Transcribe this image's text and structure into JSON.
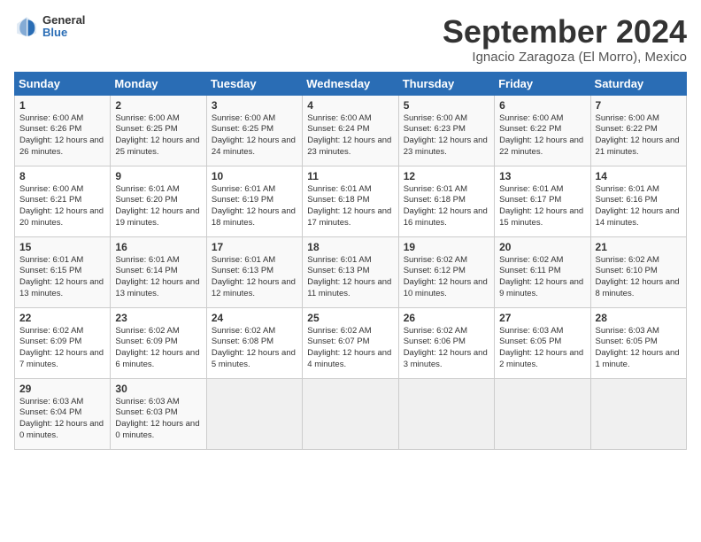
{
  "logo": {
    "general": "General",
    "blue": "Blue"
  },
  "title": "September 2024",
  "location": "Ignacio Zaragoza (El Morro), Mexico",
  "days_header": [
    "Sunday",
    "Monday",
    "Tuesday",
    "Wednesday",
    "Thursday",
    "Friday",
    "Saturday"
  ],
  "weeks": [
    [
      {
        "day": "1",
        "sunrise": "6:00 AM",
        "sunset": "6:26 PM",
        "daylight": "12 hours and 26 minutes."
      },
      {
        "day": "2",
        "sunrise": "6:00 AM",
        "sunset": "6:25 PM",
        "daylight": "12 hours and 25 minutes."
      },
      {
        "day": "3",
        "sunrise": "6:00 AM",
        "sunset": "6:25 PM",
        "daylight": "12 hours and 24 minutes."
      },
      {
        "day": "4",
        "sunrise": "6:00 AM",
        "sunset": "6:24 PM",
        "daylight": "12 hours and 23 minutes."
      },
      {
        "day": "5",
        "sunrise": "6:00 AM",
        "sunset": "6:23 PM",
        "daylight": "12 hours and 23 minutes."
      },
      {
        "day": "6",
        "sunrise": "6:00 AM",
        "sunset": "6:22 PM",
        "daylight": "12 hours and 22 minutes."
      },
      {
        "day": "7",
        "sunrise": "6:00 AM",
        "sunset": "6:22 PM",
        "daylight": "12 hours and 21 minutes."
      }
    ],
    [
      {
        "day": "8",
        "sunrise": "6:00 AM",
        "sunset": "6:21 PM",
        "daylight": "12 hours and 20 minutes."
      },
      {
        "day": "9",
        "sunrise": "6:01 AM",
        "sunset": "6:20 PM",
        "daylight": "12 hours and 19 minutes."
      },
      {
        "day": "10",
        "sunrise": "6:01 AM",
        "sunset": "6:19 PM",
        "daylight": "12 hours and 18 minutes."
      },
      {
        "day": "11",
        "sunrise": "6:01 AM",
        "sunset": "6:18 PM",
        "daylight": "12 hours and 17 minutes."
      },
      {
        "day": "12",
        "sunrise": "6:01 AM",
        "sunset": "6:18 PM",
        "daylight": "12 hours and 16 minutes."
      },
      {
        "day": "13",
        "sunrise": "6:01 AM",
        "sunset": "6:17 PM",
        "daylight": "12 hours and 15 minutes."
      },
      {
        "day": "14",
        "sunrise": "6:01 AM",
        "sunset": "6:16 PM",
        "daylight": "12 hours and 14 minutes."
      }
    ],
    [
      {
        "day": "15",
        "sunrise": "6:01 AM",
        "sunset": "6:15 PM",
        "daylight": "12 hours and 13 minutes."
      },
      {
        "day": "16",
        "sunrise": "6:01 AM",
        "sunset": "6:14 PM",
        "daylight": "12 hours and 13 minutes."
      },
      {
        "day": "17",
        "sunrise": "6:01 AM",
        "sunset": "6:13 PM",
        "daylight": "12 hours and 12 minutes."
      },
      {
        "day": "18",
        "sunrise": "6:01 AM",
        "sunset": "6:13 PM",
        "daylight": "12 hours and 11 minutes."
      },
      {
        "day": "19",
        "sunrise": "6:02 AM",
        "sunset": "6:12 PM",
        "daylight": "12 hours and 10 minutes."
      },
      {
        "day": "20",
        "sunrise": "6:02 AM",
        "sunset": "6:11 PM",
        "daylight": "12 hours and 9 minutes."
      },
      {
        "day": "21",
        "sunrise": "6:02 AM",
        "sunset": "6:10 PM",
        "daylight": "12 hours and 8 minutes."
      }
    ],
    [
      {
        "day": "22",
        "sunrise": "6:02 AM",
        "sunset": "6:09 PM",
        "daylight": "12 hours and 7 minutes."
      },
      {
        "day": "23",
        "sunrise": "6:02 AM",
        "sunset": "6:09 PM",
        "daylight": "12 hours and 6 minutes."
      },
      {
        "day": "24",
        "sunrise": "6:02 AM",
        "sunset": "6:08 PM",
        "daylight": "12 hours and 5 minutes."
      },
      {
        "day": "25",
        "sunrise": "6:02 AM",
        "sunset": "6:07 PM",
        "daylight": "12 hours and 4 minutes."
      },
      {
        "day": "26",
        "sunrise": "6:02 AM",
        "sunset": "6:06 PM",
        "daylight": "12 hours and 3 minutes."
      },
      {
        "day": "27",
        "sunrise": "6:03 AM",
        "sunset": "6:05 PM",
        "daylight": "12 hours and 2 minutes."
      },
      {
        "day": "28",
        "sunrise": "6:03 AM",
        "sunset": "6:05 PM",
        "daylight": "12 hours and 1 minute."
      }
    ],
    [
      {
        "day": "29",
        "sunrise": "6:03 AM",
        "sunset": "6:04 PM",
        "daylight": "12 hours and 0 minutes."
      },
      {
        "day": "30",
        "sunrise": "6:03 AM",
        "sunset": "6:03 PM",
        "daylight": "12 hours and 0 minutes."
      },
      null,
      null,
      null,
      null,
      null
    ]
  ]
}
